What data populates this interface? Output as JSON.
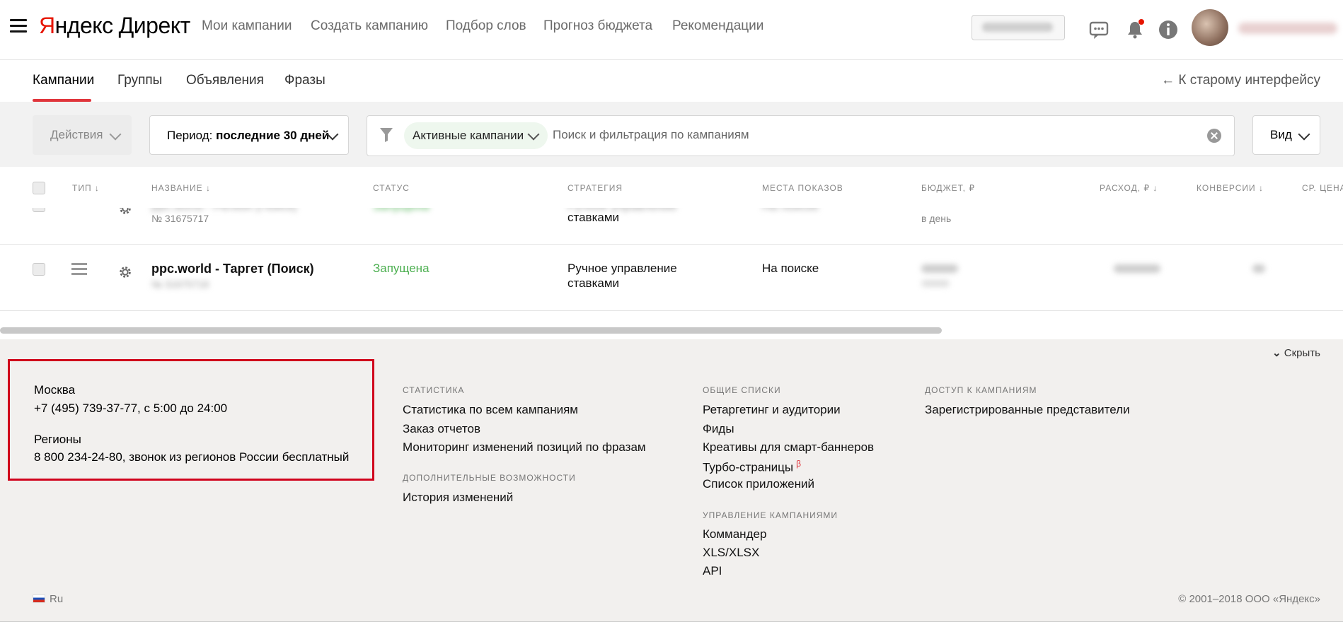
{
  "header": {
    "logo_first": "Я",
    "logo_rest": "ндекс",
    "logo_product": "Директ",
    "nav": [
      "Мои кампании",
      "Создать кампанию",
      "Подбор слов",
      "Прогноз бюджета",
      "Рекомендации"
    ]
  },
  "tabs": {
    "items": [
      "Кампании",
      "Группы",
      "Объявления",
      "Фразы"
    ],
    "old_ui": "← К старому интерфейсу"
  },
  "toolbar": {
    "actions": "Действия",
    "period_label": "Период:",
    "period_value": "последние 30 дней",
    "filter_chip": "Активные кампании",
    "search_placeholder": "Поиск и фильтрация по кампаниям",
    "view": "Вид"
  },
  "table": {
    "columns": [
      "Тип ↓",
      "Название ↓",
      "Статус",
      "Стратегия",
      "Места показов",
      "Бюджет, ₽",
      "Расход, ₽ ↓",
      "Конверсии ↓",
      "Ср. цена"
    ],
    "rows": [
      {
        "name": "ppc.world - Регион (Поиск)",
        "number": "№ 31675717",
        "status": "Запущена",
        "strategy_line1": "Ручное управление",
        "strategy_line2": "ставками",
        "placement": "На поиске",
        "budget_sub": "в день"
      },
      {
        "name": "ppc.world - Таргет (Поиск)",
        "number": "№ 31675718",
        "status": "Запущена",
        "strategy_line1": "Ручное управление",
        "strategy_line2": "ставками",
        "placement": "На поиске"
      }
    ]
  },
  "footer": {
    "hide": "Скрыть",
    "contact": {
      "city": "Москва",
      "city_phone": "+7 (495) 739-37-77, с 5:00 до 24:00",
      "regions": "Регионы",
      "regions_phone": "8 800 234-24-80, звонок из регионов России бесплатный"
    },
    "statistics": {
      "title": "Статистика",
      "links": [
        "Статистика по всем кампаниям",
        "Заказ отчетов",
        "Мониторинг изменений позиций по фразам"
      ]
    },
    "extra": {
      "title": "Дополнительные возможности",
      "links": [
        "История изменений"
      ]
    },
    "shared": {
      "title": "Общие списки",
      "links": [
        "Ретаргетинг и аудитории",
        "Фиды",
        "Креативы для смарт-баннеров",
        "Турбо-страницы",
        "Список приложений"
      ],
      "beta": "β"
    },
    "management": {
      "title": "Управление кампаниями",
      "links": [
        "Коммандер",
        "XLS/XLSX",
        "API"
      ]
    },
    "access": {
      "title": "Доступ к кампаниям",
      "links": [
        "Зарегистрированные представители"
      ]
    },
    "lang": "Ru",
    "copyright": "© 2001–2018 ООО «Яндекс»"
  },
  "colors": {
    "accent": "#e0353c",
    "status_ok": "#4caf50",
    "footer_bg": "#f2f0ee",
    "highlight": "#d0021b"
  }
}
